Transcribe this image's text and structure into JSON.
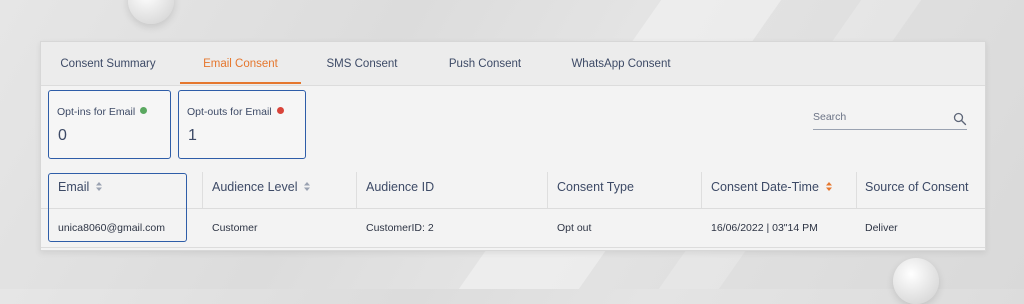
{
  "tabs": [
    {
      "label": "Consent Summary",
      "active": false
    },
    {
      "label": "Email Consent",
      "active": true
    },
    {
      "label": "SMS Consent",
      "active": false
    },
    {
      "label": "Push Consent",
      "active": false
    },
    {
      "label": "WhatsApp Consent",
      "active": false
    }
  ],
  "stats": {
    "optins": {
      "label": "Opt-ins for Email",
      "value": "0",
      "dot_color": "#5aa860"
    },
    "optouts": {
      "label": "Opt-outs for Email",
      "value": "1",
      "dot_color": "#d9443a"
    }
  },
  "search": {
    "placeholder": "Search",
    "icon": "search-icon"
  },
  "table": {
    "columns": [
      "Email",
      "Audience Level",
      "Audience ID",
      "Consent Type",
      "Consent Date-Time",
      "Source of Consent"
    ],
    "rows": [
      [
        "unica8060@gmail.com",
        "Customer",
        "CustomerID: 2",
        "Opt out",
        "16/06/2022 | 03\"14 PM",
        "Deliver"
      ]
    ]
  },
  "colors": {
    "accent": "#e5772e",
    "text": "#3d4a66",
    "highlight_border": "#2e5da8",
    "sort_active": "#e5772e",
    "sort_inactive": "#9aa2b1"
  }
}
